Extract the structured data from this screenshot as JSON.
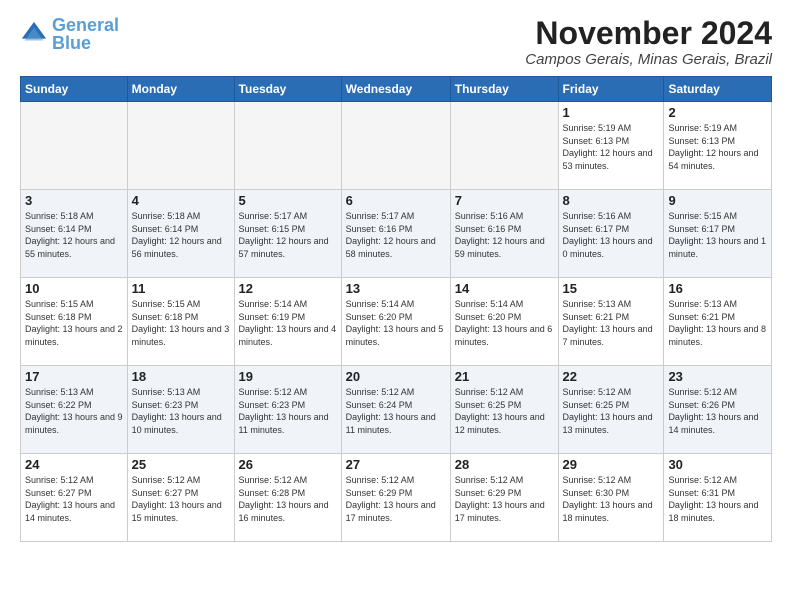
{
  "header": {
    "logo_text1": "General",
    "logo_text2": "Blue",
    "month_year": "November 2024",
    "location": "Campos Gerais, Minas Gerais, Brazil"
  },
  "weekdays": [
    "Sunday",
    "Monday",
    "Tuesday",
    "Wednesday",
    "Thursday",
    "Friday",
    "Saturday"
  ],
  "weeks": [
    [
      {
        "day": "",
        "empty": true
      },
      {
        "day": "",
        "empty": true
      },
      {
        "day": "",
        "empty": true
      },
      {
        "day": "",
        "empty": true
      },
      {
        "day": "",
        "empty": true
      },
      {
        "day": "1",
        "sunrise": "Sunrise: 5:19 AM",
        "sunset": "Sunset: 6:13 PM",
        "daylight": "Daylight: 12 hours and 53 minutes."
      },
      {
        "day": "2",
        "sunrise": "Sunrise: 5:19 AM",
        "sunset": "Sunset: 6:13 PM",
        "daylight": "Daylight: 12 hours and 54 minutes."
      }
    ],
    [
      {
        "day": "3",
        "sunrise": "Sunrise: 5:18 AM",
        "sunset": "Sunset: 6:14 PM",
        "daylight": "Daylight: 12 hours and 55 minutes."
      },
      {
        "day": "4",
        "sunrise": "Sunrise: 5:18 AM",
        "sunset": "Sunset: 6:14 PM",
        "daylight": "Daylight: 12 hours and 56 minutes."
      },
      {
        "day": "5",
        "sunrise": "Sunrise: 5:17 AM",
        "sunset": "Sunset: 6:15 PM",
        "daylight": "Daylight: 12 hours and 57 minutes."
      },
      {
        "day": "6",
        "sunrise": "Sunrise: 5:17 AM",
        "sunset": "Sunset: 6:16 PM",
        "daylight": "Daylight: 12 hours and 58 minutes."
      },
      {
        "day": "7",
        "sunrise": "Sunrise: 5:16 AM",
        "sunset": "Sunset: 6:16 PM",
        "daylight": "Daylight: 12 hours and 59 minutes."
      },
      {
        "day": "8",
        "sunrise": "Sunrise: 5:16 AM",
        "sunset": "Sunset: 6:17 PM",
        "daylight": "Daylight: 13 hours and 0 minutes."
      },
      {
        "day": "9",
        "sunrise": "Sunrise: 5:15 AM",
        "sunset": "Sunset: 6:17 PM",
        "daylight": "Daylight: 13 hours and 1 minute."
      }
    ],
    [
      {
        "day": "10",
        "sunrise": "Sunrise: 5:15 AM",
        "sunset": "Sunset: 6:18 PM",
        "daylight": "Daylight: 13 hours and 2 minutes."
      },
      {
        "day": "11",
        "sunrise": "Sunrise: 5:15 AM",
        "sunset": "Sunset: 6:18 PM",
        "daylight": "Daylight: 13 hours and 3 minutes."
      },
      {
        "day": "12",
        "sunrise": "Sunrise: 5:14 AM",
        "sunset": "Sunset: 6:19 PM",
        "daylight": "Daylight: 13 hours and 4 minutes."
      },
      {
        "day": "13",
        "sunrise": "Sunrise: 5:14 AM",
        "sunset": "Sunset: 6:20 PM",
        "daylight": "Daylight: 13 hours and 5 minutes."
      },
      {
        "day": "14",
        "sunrise": "Sunrise: 5:14 AM",
        "sunset": "Sunset: 6:20 PM",
        "daylight": "Daylight: 13 hours and 6 minutes."
      },
      {
        "day": "15",
        "sunrise": "Sunrise: 5:13 AM",
        "sunset": "Sunset: 6:21 PM",
        "daylight": "Daylight: 13 hours and 7 minutes."
      },
      {
        "day": "16",
        "sunrise": "Sunrise: 5:13 AM",
        "sunset": "Sunset: 6:21 PM",
        "daylight": "Daylight: 13 hours and 8 minutes."
      }
    ],
    [
      {
        "day": "17",
        "sunrise": "Sunrise: 5:13 AM",
        "sunset": "Sunset: 6:22 PM",
        "daylight": "Daylight: 13 hours and 9 minutes."
      },
      {
        "day": "18",
        "sunrise": "Sunrise: 5:13 AM",
        "sunset": "Sunset: 6:23 PM",
        "daylight": "Daylight: 13 hours and 10 minutes."
      },
      {
        "day": "19",
        "sunrise": "Sunrise: 5:12 AM",
        "sunset": "Sunset: 6:23 PM",
        "daylight": "Daylight: 13 hours and 11 minutes."
      },
      {
        "day": "20",
        "sunrise": "Sunrise: 5:12 AM",
        "sunset": "Sunset: 6:24 PM",
        "daylight": "Daylight: 13 hours and 11 minutes."
      },
      {
        "day": "21",
        "sunrise": "Sunrise: 5:12 AM",
        "sunset": "Sunset: 6:25 PM",
        "daylight": "Daylight: 13 hours and 12 minutes."
      },
      {
        "day": "22",
        "sunrise": "Sunrise: 5:12 AM",
        "sunset": "Sunset: 6:25 PM",
        "daylight": "Daylight: 13 hours and 13 minutes."
      },
      {
        "day": "23",
        "sunrise": "Sunrise: 5:12 AM",
        "sunset": "Sunset: 6:26 PM",
        "daylight": "Daylight: 13 hours and 14 minutes."
      }
    ],
    [
      {
        "day": "24",
        "sunrise": "Sunrise: 5:12 AM",
        "sunset": "Sunset: 6:27 PM",
        "daylight": "Daylight: 13 hours and 14 minutes."
      },
      {
        "day": "25",
        "sunrise": "Sunrise: 5:12 AM",
        "sunset": "Sunset: 6:27 PM",
        "daylight": "Daylight: 13 hours and 15 minutes."
      },
      {
        "day": "26",
        "sunrise": "Sunrise: 5:12 AM",
        "sunset": "Sunset: 6:28 PM",
        "daylight": "Daylight: 13 hours and 16 minutes."
      },
      {
        "day": "27",
        "sunrise": "Sunrise: 5:12 AM",
        "sunset": "Sunset: 6:29 PM",
        "daylight": "Daylight: 13 hours and 17 minutes."
      },
      {
        "day": "28",
        "sunrise": "Sunrise: 5:12 AM",
        "sunset": "Sunset: 6:29 PM",
        "daylight": "Daylight: 13 hours and 17 minutes."
      },
      {
        "day": "29",
        "sunrise": "Sunrise: 5:12 AM",
        "sunset": "Sunset: 6:30 PM",
        "daylight": "Daylight: 13 hours and 18 minutes."
      },
      {
        "day": "30",
        "sunrise": "Sunrise: 5:12 AM",
        "sunset": "Sunset: 6:31 PM",
        "daylight": "Daylight: 13 hours and 18 minutes."
      }
    ]
  ]
}
